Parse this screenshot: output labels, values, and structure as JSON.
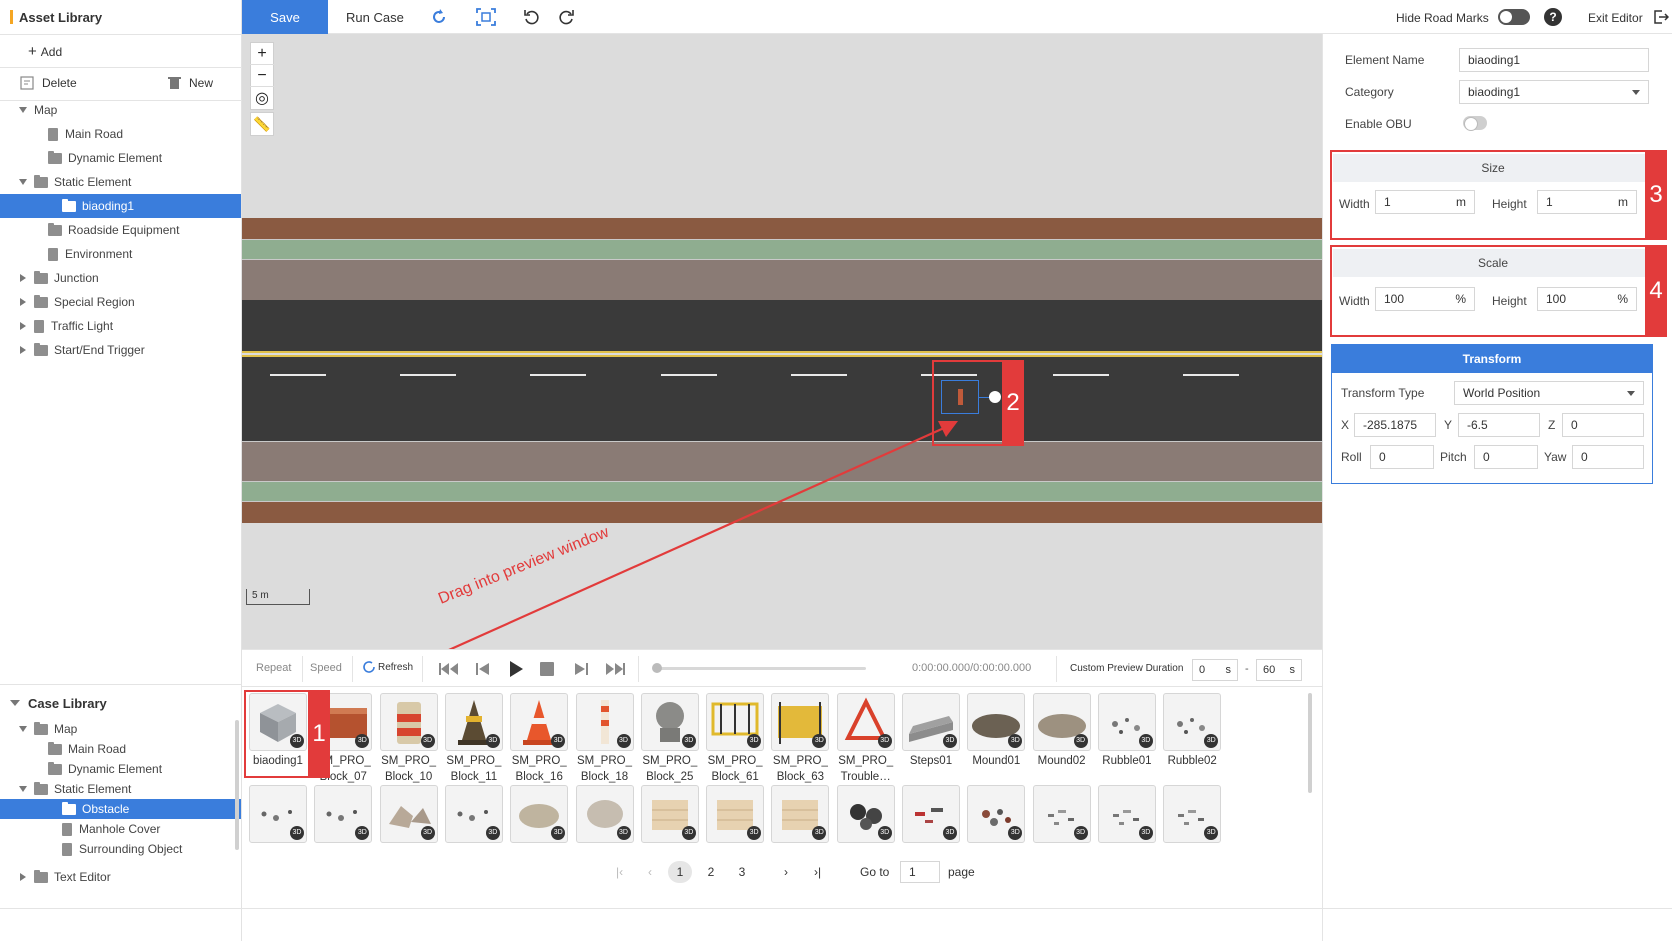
{
  "asset_library": {
    "title": "Asset Library",
    "add_label": "Add",
    "delete_label": "Delete",
    "new_label": "New",
    "tree": [
      {
        "label": "Map",
        "toggle": "down",
        "indent": 0,
        "icon": "none"
      },
      {
        "label": "Main Road",
        "toggle": "none",
        "indent": 1,
        "icon": "road-icon"
      },
      {
        "label": "Dynamic Element",
        "toggle": "none",
        "indent": 1,
        "icon": "folder-icon"
      },
      {
        "label": "Static Element",
        "toggle": "down",
        "indent": 0,
        "icon": "folder-open-icon"
      },
      {
        "label": "biaoding1",
        "toggle": "none",
        "indent": 2,
        "icon": "folder-open-icon",
        "selected": true
      },
      {
        "label": "Roadside Equipment",
        "toggle": "none",
        "indent": 1,
        "icon": "folder-icon"
      },
      {
        "label": "Environment",
        "toggle": "none",
        "indent": 1,
        "icon": "environment-icon"
      },
      {
        "label": "Junction",
        "toggle": "right",
        "indent": 0,
        "icon": "folder-icon"
      },
      {
        "label": "Special Region",
        "toggle": "right",
        "indent": 0,
        "icon": "folder-icon"
      },
      {
        "label": "Traffic Light",
        "toggle": "right",
        "indent": 0,
        "icon": "traffic-light-icon"
      },
      {
        "label": "Start/End Trigger",
        "toggle": "right",
        "indent": 0,
        "icon": "folder-icon"
      }
    ]
  },
  "case_library": {
    "title": "Case Library",
    "tree": [
      {
        "label": "Map",
        "toggle": "down",
        "indent": 0,
        "icon": "folder-open-icon"
      },
      {
        "label": "Main Road",
        "toggle": "none",
        "indent": 1,
        "icon": "folder-icon"
      },
      {
        "label": "Dynamic Element",
        "toggle": "none",
        "indent": 1,
        "icon": "folder-icon"
      },
      {
        "label": "Static Element",
        "toggle": "down",
        "indent": 0,
        "icon": "folder-open-icon"
      },
      {
        "label": "Obstacle",
        "toggle": "none",
        "indent": 2,
        "icon": "folder-open-icon",
        "selected": true
      },
      {
        "label": "Manhole Cover",
        "toggle": "none",
        "indent": 2,
        "icon": "person-icon"
      },
      {
        "label": "Surrounding Object",
        "toggle": "none",
        "indent": 2,
        "icon": "document-icon"
      },
      {
        "label": "Text Editor",
        "toggle": "right",
        "indent": 0,
        "icon": "folder-icon"
      }
    ]
  },
  "toolbar": {
    "save_label": "Save",
    "run_case_label": "Run Case",
    "icons": [
      "redo-arrow-icon",
      "focus-frame-icon",
      "rotate-left-icon",
      "rotate-right-icon"
    ],
    "hide_road_marks_label": "Hide Road Marks",
    "exit_editor_label": "Exit Editor",
    "help_icon": "help-icon"
  },
  "canvas": {
    "scale_label": "5 m",
    "annotation_text": "Drag into preview window",
    "marker_1": "1",
    "marker_2": "2"
  },
  "playbar": {
    "repeat_label": "Repeat",
    "speed_label": "Speed",
    "refresh_label": "Refresh",
    "time_label": "0:00:00.000/0:00:00.000",
    "duration_label": "Custom Preview Duration",
    "start_value": "0",
    "start_unit": "s",
    "dash": "-",
    "end_value": "60",
    "end_unit": "s"
  },
  "assets": [
    {
      "name": "biaoding1",
      "name2": "",
      "thumb": "gray-cube"
    },
    {
      "name": "SM_PRO_",
      "name2": "Block_07",
      "thumb": "brick-pile"
    },
    {
      "name": "SM_PRO_",
      "name2": "Block_10",
      "thumb": "barrel"
    },
    {
      "name": "SM_PRO_",
      "name2": "Block_11",
      "thumb": "cone-dark"
    },
    {
      "name": "SM_PRO_",
      "name2": "Block_16",
      "thumb": "cone-orange"
    },
    {
      "name": "SM_PRO_",
      "name2": "Block_18",
      "thumb": "post"
    },
    {
      "name": "SM_PRO_",
      "name2": "Block_25",
      "thumb": "stone-ball"
    },
    {
      "name": "SM_PRO_",
      "name2": "Block_61",
      "thumb": "fence-yellow"
    },
    {
      "name": "SM_PRO_",
      "name2": "Block_63",
      "thumb": "board-yellow"
    },
    {
      "name": "SM_PRO_",
      "name2": "Trouble…",
      "thumb": "triangle"
    },
    {
      "name": "Steps01",
      "name2": "",
      "thumb": "steps"
    },
    {
      "name": "Mound01",
      "name2": "",
      "thumb": "mound"
    },
    {
      "name": "Mound02",
      "name2": "",
      "thumb": "mound-light"
    },
    {
      "name": "Rubble01",
      "name2": "",
      "thumb": "rubble"
    },
    {
      "name": "Rubble02",
      "name2": "",
      "thumb": "rubble"
    },
    {
      "name": "",
      "name2": "",
      "thumb": "rubble-small"
    },
    {
      "name": "",
      "name2": "",
      "thumb": "rubble-small"
    },
    {
      "name": "",
      "name2": "",
      "thumb": "rocks"
    },
    {
      "name": "",
      "name2": "",
      "thumb": "rubble-small"
    },
    {
      "name": "",
      "name2": "",
      "thumb": "rock-flat"
    },
    {
      "name": "",
      "name2": "",
      "thumb": "rock-round"
    },
    {
      "name": "",
      "name2": "",
      "thumb": "crate"
    },
    {
      "name": "",
      "name2": "",
      "thumb": "crate"
    },
    {
      "name": "",
      "name2": "",
      "thumb": "crate"
    },
    {
      "name": "",
      "name2": "",
      "thumb": "tires"
    },
    {
      "name": "",
      "name2": "",
      "thumb": "debris-red"
    },
    {
      "name": "",
      "name2": "",
      "thumb": "debris-mixed"
    },
    {
      "name": "",
      "name2": "",
      "thumb": "debris-gray"
    },
    {
      "name": "",
      "name2": "",
      "thumb": "debris-gray"
    },
    {
      "name": "",
      "name2": "",
      "thumb": "debris-gray"
    }
  ],
  "pagination": {
    "pages": [
      "1",
      "2",
      "3"
    ],
    "current": "1",
    "goto_label": "Go to",
    "goto_value": "1",
    "page_label": "page"
  },
  "properties": {
    "element_name_label": "Element Name",
    "element_name_value": "biaoding1",
    "category_label": "Category",
    "category_value": "biaoding1",
    "enable_obu_label": "Enable OBU",
    "size_title": "Size",
    "size_width_label": "Width",
    "size_width_value": "1",
    "size_width_unit": "m",
    "size_height_label": "Height",
    "size_height_value": "1",
    "size_height_unit": "m",
    "scale_title": "Scale",
    "scale_width_label": "Width",
    "scale_width_value": "100",
    "scale_width_unit": "%",
    "scale_height_label": "Height",
    "scale_height_value": "100",
    "scale_height_unit": "%",
    "transform_title": "Transform",
    "transform_type_label": "Transform Type",
    "transform_type_value": "World Position",
    "x_label": "X",
    "x_value": "-285.1875",
    "y_label": "Y",
    "y_value": "-6.5",
    "z_label": "Z",
    "z_value": "0",
    "roll_label": "Roll",
    "roll_value": "0",
    "pitch_label": "Pitch",
    "pitch_value": "0",
    "yaw_label": "Yaw",
    "yaw_value": "0",
    "marker_3": "3",
    "marker_4": "4"
  },
  "colors": {
    "accent": "#3a7ddc",
    "annotation_red": "#e23b3b",
    "road_asphalt": "#3c3c3c",
    "road_center_line": "#e8c23a"
  }
}
